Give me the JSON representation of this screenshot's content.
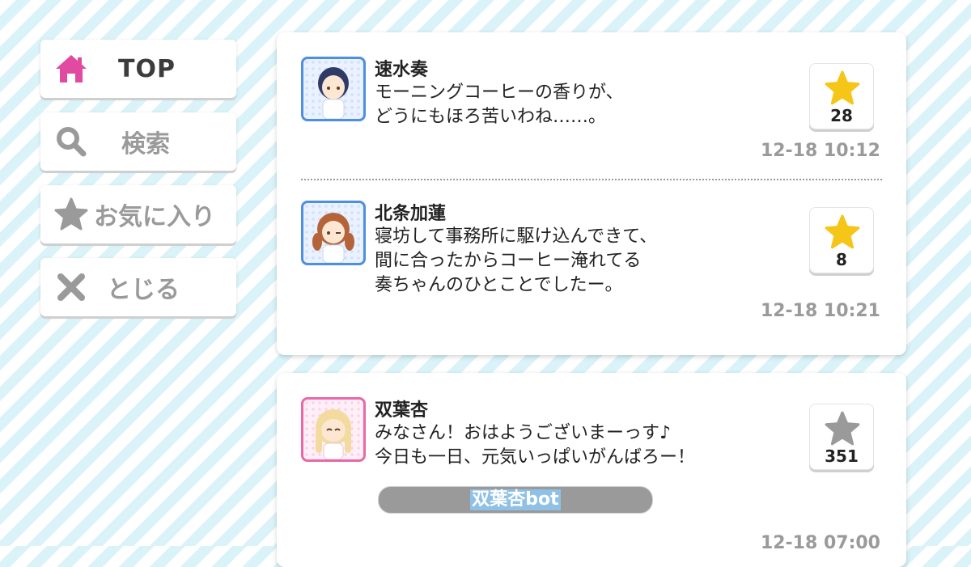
{
  "nav": {
    "top": {
      "label": "TOP",
      "icon": "home-icon",
      "color": "#e14aa0"
    },
    "search": {
      "label": "検索",
      "icon": "search-icon"
    },
    "favorites": {
      "label": "お気に入り",
      "icon": "star-icon"
    },
    "close": {
      "label": "とじる",
      "icon": "close-icon"
    }
  },
  "feed": {
    "posts": [
      {
        "name": "速水奏",
        "lines": [
          "モーニングコーヒーの香りが、",
          "どうにもほろ苦いわね……。"
        ],
        "likes": "28",
        "liked": true,
        "time": "12-18 10:12",
        "avatar_color": "#4f8fe0"
      },
      {
        "name": "北条加蓮",
        "lines": [
          "寝坊して事務所に駆け込んできて、",
          "間に合ったからコーヒー淹れてる",
          "奏ちゃんのひとことでしたー。"
        ],
        "likes": "8",
        "liked": true,
        "time": "12-18 10:21",
        "avatar_color": "#4f8fe0"
      },
      {
        "name": "双葉杏",
        "lines": [
          "みなさん！おはようございまーっす♪",
          "今日も一日、元気いっぱいがんばろー！"
        ],
        "likes": "351",
        "liked": false,
        "tag": "双葉杏bot",
        "time": "12-18 07:00",
        "avatar_color": "#e868a8"
      }
    ]
  },
  "colors": {
    "star_active": "#f5c518",
    "star_inactive": "#9a9a9a",
    "stripe": "#d9f3f9"
  }
}
